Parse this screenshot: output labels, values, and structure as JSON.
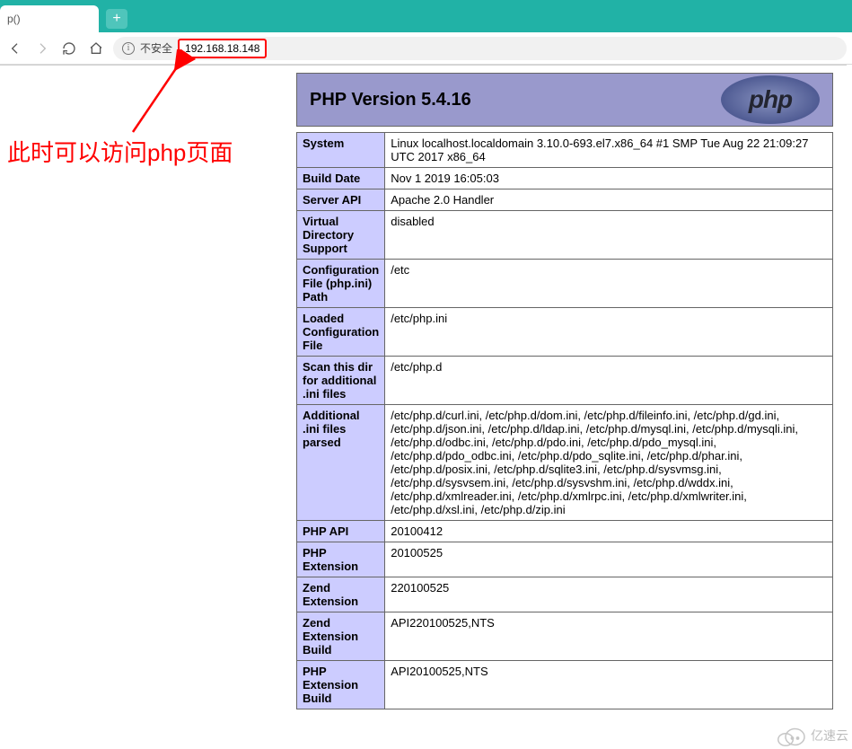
{
  "browser": {
    "tab_title": "p()",
    "new_tab_label": "+",
    "insecure_label": "不安全",
    "url": "192.168.18.148"
  },
  "annotation": {
    "text": "此时可以访问php页面"
  },
  "php": {
    "title": "PHP Version 5.4.16",
    "logo_text": "php",
    "rows": [
      {
        "k": "System",
        "v": "Linux localhost.localdomain 3.10.0-693.el7.x86_64 #1 SMP Tue Aug 22 21:09:27 UTC 2017 x86_64"
      },
      {
        "k": "Build Date",
        "v": "Nov 1 2019 16:05:03"
      },
      {
        "k": "Server API",
        "v": "Apache 2.0 Handler"
      },
      {
        "k": "Virtual Directory Support",
        "v": "disabled"
      },
      {
        "k": "Configuration File (php.ini) Path",
        "v": "/etc"
      },
      {
        "k": "Loaded Configuration File",
        "v": "/etc/php.ini"
      },
      {
        "k": "Scan this dir for additional .ini files",
        "v": "/etc/php.d"
      },
      {
        "k": "Additional .ini files parsed",
        "v": "/etc/php.d/curl.ini, /etc/php.d/dom.ini, /etc/php.d/fileinfo.ini, /etc/php.d/gd.ini, /etc/php.d/json.ini, /etc/php.d/ldap.ini, /etc/php.d/mysql.ini, /etc/php.d/mysqli.ini, /etc/php.d/odbc.ini, /etc/php.d/pdo.ini, /etc/php.d/pdo_mysql.ini, /etc/php.d/pdo_odbc.ini, /etc/php.d/pdo_sqlite.ini, /etc/php.d/phar.ini, /etc/php.d/posix.ini, /etc/php.d/sqlite3.ini, /etc/php.d/sysvmsg.ini, /etc/php.d/sysvsem.ini, /etc/php.d/sysvshm.ini, /etc/php.d/wddx.ini, /etc/php.d/xmlreader.ini, /etc/php.d/xmlrpc.ini, /etc/php.d/xmlwriter.ini, /etc/php.d/xsl.ini, /etc/php.d/zip.ini"
      },
      {
        "k": "PHP API",
        "v": "20100412"
      },
      {
        "k": "PHP Extension",
        "v": "20100525"
      },
      {
        "k": "Zend Extension",
        "v": "220100525"
      },
      {
        "k": "Zend Extension Build",
        "v": "API220100525,NTS"
      },
      {
        "k": "PHP Extension Build",
        "v": "API20100525,NTS"
      }
    ]
  },
  "watermark": {
    "text": "亿速云"
  }
}
